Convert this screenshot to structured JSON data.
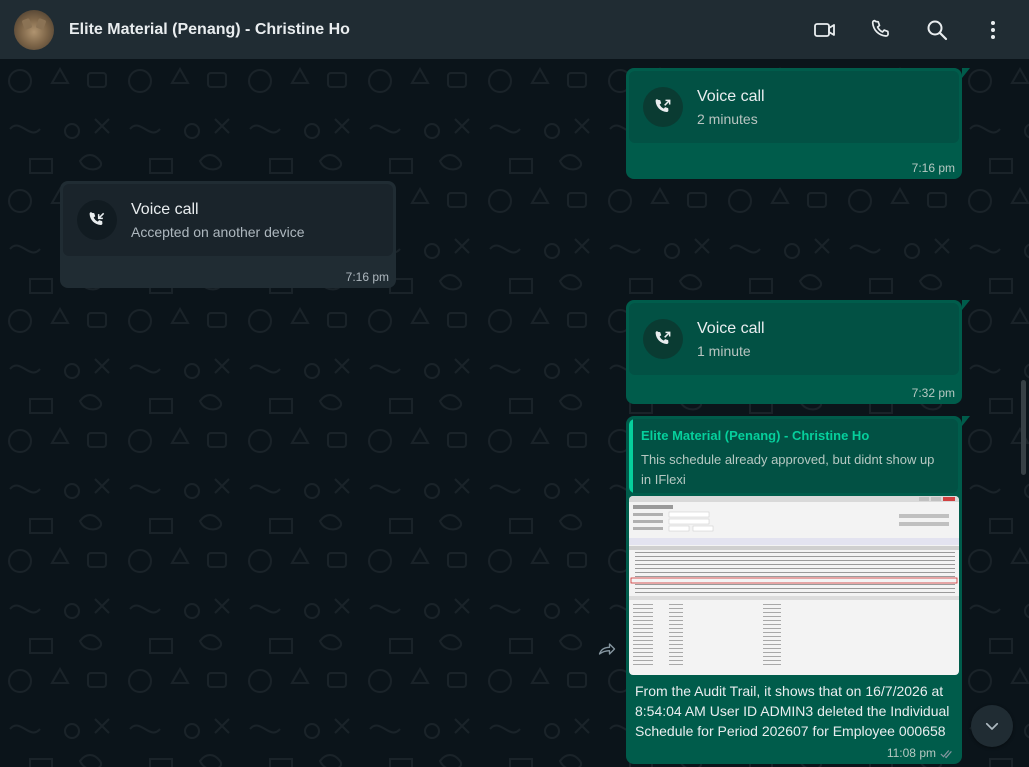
{
  "header": {
    "contact_name": "Elite Material (Penang) - Christine Ho",
    "icons": [
      "video-call-icon",
      "phone-icon",
      "search-icon",
      "menu-dots-icon"
    ]
  },
  "messages": [
    {
      "direction": "outgoing",
      "type": "call",
      "title": "Voice call",
      "subtitle": "2 minutes",
      "time": "7:16 pm",
      "call_icon": "outgoing-call-icon"
    },
    {
      "direction": "incoming",
      "type": "call",
      "title": "Voice call",
      "subtitle": "Accepted on another device",
      "time": "7:16 pm",
      "call_icon": "incoming-call-icon"
    },
    {
      "direction": "outgoing",
      "type": "call",
      "title": "Voice call",
      "subtitle": "1 minute",
      "time": "7:32 pm",
      "call_icon": "outgoing-call-icon"
    },
    {
      "direction": "outgoing",
      "type": "reply_image",
      "quote": {
        "name": "Elite Material (Penang) - Christine Ho",
        "text": "This schedule already approved, but didnt show up in IFlexi"
      },
      "image_icon": "audit-trail-screenshot",
      "caption": "From the Audit Trail, it shows that on 16/7/2026 at 8:54:04 AM User ID ADMIN3 deleted the Individual Schedule for Period 202607 for Employee 000658",
      "time": "11:08 pm",
      "status_icon": "double-check-icon"
    }
  ],
  "colors": {
    "header_bg": "#202c33",
    "chat_bg": "#0b141a",
    "outgoing_bubble": "#005c4b",
    "incoming_bubble": "#202c33",
    "accent": "#06cf9c"
  }
}
